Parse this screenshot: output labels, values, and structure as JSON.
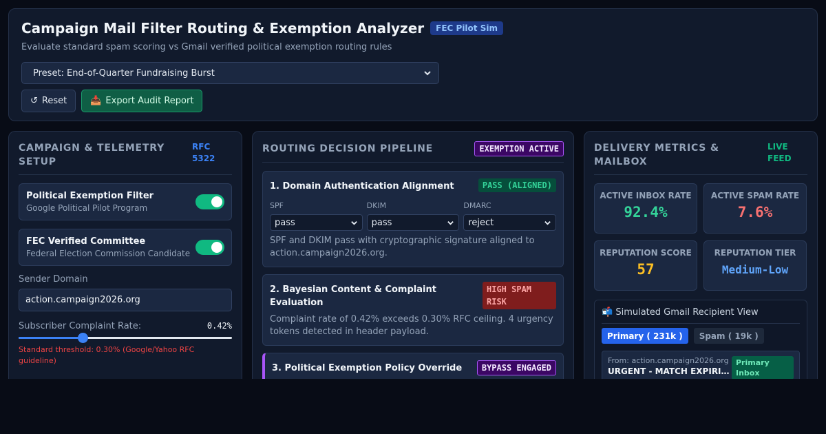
{
  "header": {
    "title": "Campaign Mail Filter Routing & Exemption Analyzer",
    "badge": "FEC Pilot Sim",
    "subtitle": "Evaluate standard spam scoring vs Gmail verified political exemption routing rules",
    "preset": "Preset: End-of-Quarter Fundraising Burst",
    "reset_label": "Reset",
    "export_label": "Export Audit Report"
  },
  "setup": {
    "title": "CAMPAIGN & TELEMETRY SETUP",
    "tag": "RFC 5322",
    "exemption": {
      "title": "Political Exemption Filter",
      "sub": "Google Political Pilot Program",
      "on": true
    },
    "fec": {
      "title": "FEC Verified Committee",
      "sub": "Federal Election Commission Candidate",
      "on": true
    },
    "domain_label": "Sender Domain",
    "domain_value": "action.campaign2026.org",
    "complaint_label": "Subscriber Complaint Rate:",
    "complaint_value": "0.42%",
    "complaint_fraction": 0.3,
    "threshold_note": "Standard threshold: 0.30% (Google/Yahoo RFC guideline)"
  },
  "pipeline": {
    "title": "ROUTING DECISION PIPELINE",
    "status": "EXEMPTION ACTIVE",
    "stage1": {
      "title": "1. Domain Authentication Alignment",
      "badge": "PASS (ALIGNED)",
      "spf_label": "SPF",
      "spf_value": "pass",
      "dkim_label": "DKIM",
      "dkim_value": "pass",
      "dmarc_label": "DMARC",
      "dmarc_value": "reject",
      "desc": "SPF and DKIM pass with cryptographic signature aligned to action.campaign2026.org."
    },
    "stage2": {
      "title": "2. Bayesian Content & Complaint Evaluation",
      "badge": "HIGH SPAM RISK",
      "desc": "Complaint rate of 0.42% exceeds 0.30% RFC ceiling. 4 urgency tokens detected in header payload."
    },
    "stage3": {
      "title": "3. Political Exemption Policy Override",
      "badge": "BYPASS ENGAGED"
    }
  },
  "metrics": {
    "title": "DELIVERY METRICS & MAILBOX",
    "tag": "LIVE FEED",
    "inbox_label": "ACTIVE INBOX RATE",
    "inbox_value": "92.4%",
    "inbox_color": "#34d399",
    "spam_label": "ACTIVE SPAM RATE",
    "spam_value": "7.6%",
    "spam_color": "#f87171",
    "rep_label": "REPUTATION SCORE",
    "rep_value": "57",
    "rep_color": "#fbbf24",
    "tier_label": "REPUTATION TIER",
    "tier_value": "Medium-Low",
    "tier_color": "#60a5fa"
  },
  "mailbox": {
    "title": "Simulated Gmail Recipient View",
    "tab_primary": "Primary ( 231k )",
    "tab_spam": "Spam ( 19k )",
    "item": {
      "from": "From: action.campaign2026.org",
      "subject": "URGENT - MATCH EXPIRING TONIGHT",
      "badge": "Primary Inbox"
    }
  }
}
